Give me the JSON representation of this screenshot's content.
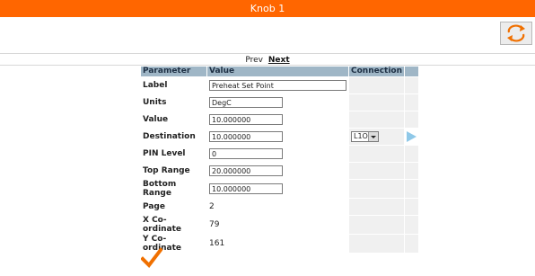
{
  "window": {
    "title": "Knob 1"
  },
  "nav": {
    "prev_label": "Prev",
    "next_label": "Next"
  },
  "table": {
    "headers": {
      "parameter": "Parameter",
      "value": "Value",
      "connection": "Connection"
    },
    "rows": {
      "label": {
        "name": "Label",
        "value": "Preheat Set Point"
      },
      "units": {
        "name": "Units",
        "value": "DegC"
      },
      "value": {
        "name": "Value",
        "value": "10.000000"
      },
      "destination": {
        "name": "Destination",
        "value": "10.000000",
        "connection": "L1O"
      },
      "pin_level": {
        "name": "PIN Level",
        "value": "0"
      },
      "top_range": {
        "name": "Top Range",
        "value": "20.000000"
      },
      "bottom_range": {
        "name": "Bottom Range",
        "value": "10.000000"
      },
      "page": {
        "name": "Page",
        "value": "2"
      },
      "x_coord": {
        "name": "X Co-ordinate",
        "value": "79"
      },
      "y_coord": {
        "name": "Y Co-ordinate",
        "value": "161"
      }
    }
  },
  "icons": {
    "refresh": "refresh-icon",
    "check": "checkmark-icon",
    "play": "play-arrow-icon"
  },
  "colors": {
    "title_bar": "#ff6600",
    "header_bg": "#9fb6c6",
    "accent_orange": "#ff6600",
    "play_arrow": "#8fc8e8"
  }
}
